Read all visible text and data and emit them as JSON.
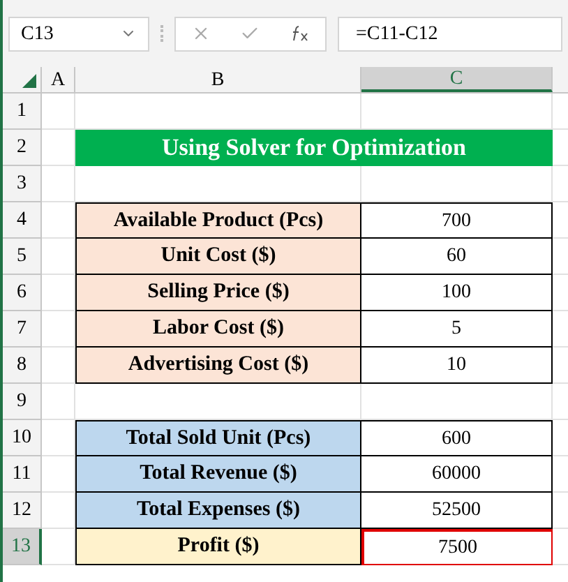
{
  "name_box": "C13",
  "formula": "=C11-C12",
  "columns": [
    {
      "label": "A",
      "selected": false
    },
    {
      "label": "B",
      "selected": false
    },
    {
      "label": "C",
      "selected": true
    }
  ],
  "row_headers": [
    {
      "label": "1",
      "selected": false
    },
    {
      "label": "2",
      "selected": false
    },
    {
      "label": "3",
      "selected": false
    },
    {
      "label": "4",
      "selected": false
    },
    {
      "label": "5",
      "selected": false
    },
    {
      "label": "6",
      "selected": false
    },
    {
      "label": "7",
      "selected": false
    },
    {
      "label": "8",
      "selected": false
    },
    {
      "label": "9",
      "selected": false
    },
    {
      "label": "10",
      "selected": false
    },
    {
      "label": "11",
      "selected": false
    },
    {
      "label": "12",
      "selected": false
    },
    {
      "label": "13",
      "selected": true
    }
  ],
  "title": "Using Solver for Optimization",
  "inputs": [
    {
      "label": "Available Product (Pcs)",
      "value": "700",
      "color": "#fce4d6",
      "selected": false
    },
    {
      "label": "Unit Cost ($)",
      "value": "60",
      "color": "#fce4d6",
      "selected": false
    },
    {
      "label": "Selling Price ($)",
      "value": "100",
      "color": "#fce4d6",
      "selected": false
    },
    {
      "label": "Labor Cost ($)",
      "value": "5",
      "color": "#fce4d6",
      "selected": false
    },
    {
      "label": "Advertising Cost ($)",
      "value": "10",
      "color": "#fce4d6",
      "selected": false
    }
  ],
  "results": [
    {
      "label": "Total Sold Unit (Pcs)",
      "value": "600",
      "color": "#bdd7ee",
      "selected": false
    },
    {
      "label": "Total Revenue ($)",
      "value": "60000",
      "color": "#bdd7ee",
      "selected": false
    },
    {
      "label": "Total Expenses ($)",
      "value": "52500",
      "color": "#bdd7ee",
      "selected": false
    },
    {
      "label": "Profit ($)",
      "value": "7500",
      "color": "#fff2cc",
      "selected": true
    }
  ]
}
